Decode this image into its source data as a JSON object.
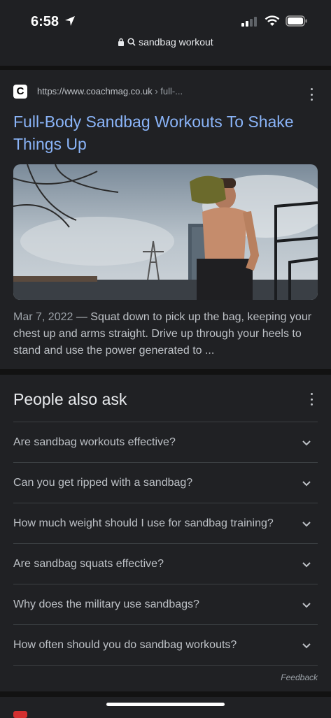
{
  "status": {
    "time": "6:58"
  },
  "browser": {
    "query": "sandbag workout"
  },
  "result": {
    "favicon_letter": "C",
    "url_domain": "https://www.coachmag.co.uk",
    "url_path": " › full-...",
    "title": "Full-Body Sandbag Workouts To Shake Things Up",
    "date": "Mar 7, 2022",
    "snippet": " — Squat down to pick up the bag, keeping your chest up and arms straight. Drive up through your heels to stand and use the power generated to ..."
  },
  "paa": {
    "heading": "People also ask",
    "questions": [
      "Are sandbag workouts effective?",
      "Can you get ripped with a sandbag?",
      "How much weight should I use for sandbag training?",
      "Are sandbag squats effective?",
      "Why does the military use sandbags?",
      "How often should you do sandbag workouts?"
    ],
    "feedback": "Feedback"
  },
  "colors": {
    "background": "#202124",
    "link": "#8ab4f8",
    "text": "#bdc1c6"
  }
}
